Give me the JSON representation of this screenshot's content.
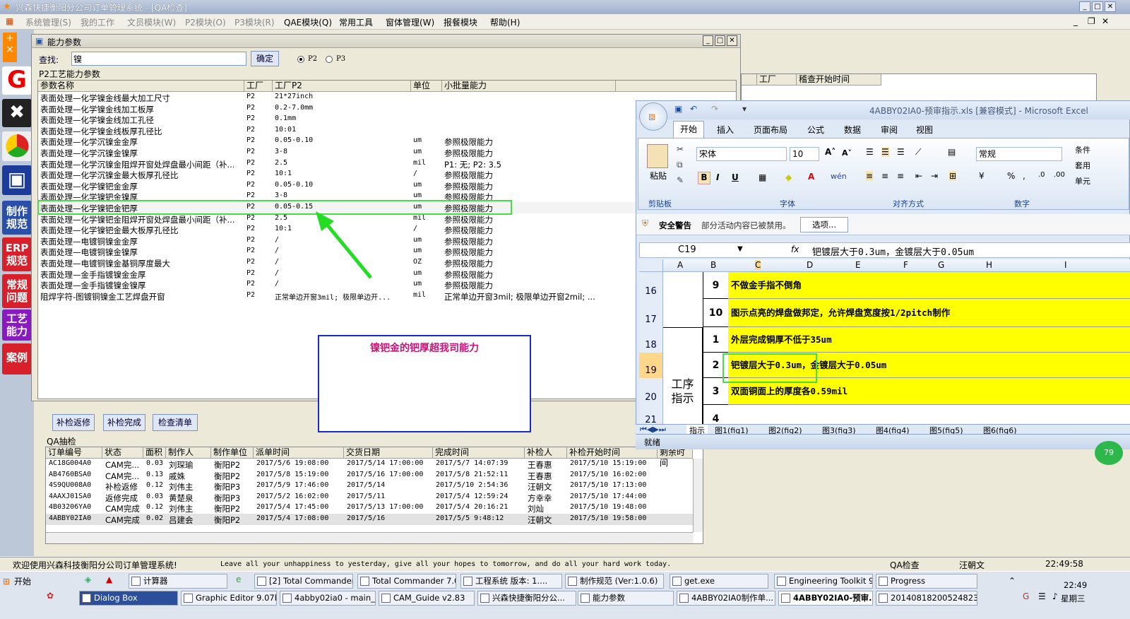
{
  "app": {
    "title": "兴森快捷衡阳分公司订单管理系统 - [QA检查]"
  },
  "menu": [
    "系统管理(S)",
    "我的工作",
    "文员模块(W)",
    "P2模块(O)",
    "P3模块(R)",
    "QAE模块(Q)",
    "常用工具",
    "窗体管理(W)",
    "报餐模块",
    "帮助(H)"
  ],
  "sidebar": {
    "buttons": [
      "制作\n规范",
      "ERP\n规范",
      "常规\n问题",
      "工艺\n能力",
      "案例"
    ]
  },
  "dialog": {
    "title": "能力参数",
    "search_label": "查找:",
    "search_value": "镍",
    "confirm": "确定",
    "radio_p2": "P2",
    "radio_p3": "P3",
    "group": "P2工艺能力参数",
    "columns": [
      "参数名称",
      "工厂",
      "工厂P2",
      "单位",
      "小批量能力"
    ],
    "rows": [
      [
        "表面处理—化学镍金线最大加工尺寸",
        "P2",
        "21*27inch",
        "",
        ""
      ],
      [
        "表面处理—化学镍金线加工板厚",
        "P2",
        "0.2-7.0mm",
        "",
        ""
      ],
      [
        "表面处理—化学镍金线加工孔径",
        "P2",
        "0.1mm",
        "",
        ""
      ],
      [
        "表面处理—化学镍金线板厚孔径比",
        "P2",
        "10:01",
        "",
        ""
      ],
      [
        "表面处理—化学沉镍金金厚",
        "P2",
        "0.05-0.10",
        "um",
        "参照极限能力"
      ],
      [
        "表面处理—化学沉镍金镍厚",
        "P2",
        "3-8",
        "um",
        "参照极限能力"
      ],
      [
        "表面处理—化学沉镍金阻焊开窗处焊盘最小间距（补...",
        "P2",
        "2.5",
        "mil",
        "P1: 无; P2: 3.5"
      ],
      [
        "表面处理—化学沉镍金最大板厚孔径比",
        "P2",
        "10:1",
        "/",
        "参照极限能力"
      ],
      [
        "表面处理—化学镍钯金金厚",
        "P2",
        "0.05-0.10",
        "um",
        "参照极限能力"
      ],
      [
        "表面处理—化学镍钯金镍厚",
        "P2",
        "3-8",
        "um",
        "参照极限能力"
      ],
      [
        "表面处理—化学镍钯金钯厚",
        "P2",
        "0.05-0.15",
        "um",
        "参照极限能力"
      ],
      [
        "表面处理—化学镍钯金阻焊开窗处焊盘最小间距（补...",
        "P2",
        "2.5",
        "mil",
        "参照极限能力"
      ],
      [
        "表面处理—化学镍钯金最大板厚孔径比",
        "P2",
        "10:1",
        "/",
        "参照极限能力"
      ],
      [
        "表面处理—电镀铜镍金金厚",
        "P2",
        "/",
        "um",
        "参照极限能力"
      ],
      [
        "表面处理—电镀铜镍金镍厚",
        "P2",
        "/",
        "um",
        "参照极限能力"
      ],
      [
        "表面处理—电镀铜镍金基铜厚度最大",
        "P2",
        "/",
        "OZ",
        "参照极限能力"
      ],
      [
        "表面处理—金手指镀镍金金厚",
        "P2",
        "/",
        "um",
        "参照极限能力"
      ],
      [
        "表面处理—金手指镀镍金镍厚",
        "P2",
        "/",
        "um",
        "参照极限能力"
      ],
      [
        "阻焊字符-图镀铜镍金工艺焊盘开窗",
        "P2",
        "正常单边开窗3mil; 极限单边开...",
        "mil",
        "正常单边开窗3mil; 极限单边开窗2mil; ..."
      ]
    ],
    "annotation": "镍钯金的钯厚超我司能力"
  },
  "bg_headers": [
    "工厂",
    "稽查开始时间"
  ],
  "buttons": {
    "recheck_return": "补检返修",
    "recheck_done": "补检完成",
    "checklist": "检查清单"
  },
  "qa": {
    "group": "QA抽检",
    "columns": [
      "订单编号",
      "状态",
      "面积",
      "制作人",
      "制作单位",
      "派单时间",
      "交货日期",
      "完成时间",
      "补检人",
      "补检开始时间",
      "剩余时间"
    ],
    "rows": [
      [
        "AC18G004A0",
        "CAM完...",
        "0.03",
        "刘琛瑜",
        "衡阳P2",
        "2017/5/6 19:08:00",
        "2017/5/14 17:00:00",
        "2017/5/7 14:07:39",
        "王春惠",
        "2017/5/10 15:19:00",
        ""
      ],
      [
        "AB4760BSA0",
        "CAM完...",
        "0.13",
        "戚姝",
        "衡阳P2",
        "2017/5/8 15:19:00",
        "2017/5/16 17:00:00",
        "2017/5/8 21:52:11",
        "王春惠",
        "2017/5/10 16:02:00",
        ""
      ],
      [
        "4S9QU008A0",
        "补检返修",
        "0.12",
        "刘伟主",
        "衡阳P3",
        "2017/5/9 17:46:00",
        "2017/5/14",
        "2017/5/10 2:54:36",
        "汪朝文",
        "2017/5/10 17:13:00",
        ""
      ],
      [
        "4AAXJ01SA0",
        "返修完成",
        "0.03",
        "黄楚泉",
        "衡阳P3",
        "2017/5/2 16:02:00",
        "2017/5/11",
        "2017/5/4 12:59:24",
        "方幸幸",
        "2017/5/10 17:44:00",
        ""
      ],
      [
        "4B03206YA0",
        "CAM完成",
        "0.12",
        "刘伟主",
        "衡阳P2",
        "2017/5/4 17:45:00",
        "2017/5/13 17:00:00",
        "2017/5/4 20:16:21",
        "刘灿",
        "2017/5/10 19:48:00",
        ""
      ],
      [
        "4ABBY02IA0",
        "CAM完成",
        "0.02",
        "吕建会",
        "衡阳P2",
        "2017/5/4 17:08:00",
        "2017/5/16",
        "2017/5/5 9:48:12",
        "汪朝文",
        "2017/5/10 19:58:00",
        ""
      ]
    ]
  },
  "excel": {
    "title": "4ABBY02IA0-预审指示.xls [兼容模式] - Microsoft Excel",
    "tabs": [
      "开始",
      "插入",
      "页面布局",
      "公式",
      "数据",
      "审阅",
      "视图"
    ],
    "font_name": "宋体",
    "font_size": "10",
    "number_format": "常规",
    "groups": [
      "剪贴板",
      "字体",
      "对齐方式",
      "数字"
    ],
    "paste": "粘贴",
    "right_items": [
      "条件",
      "套用",
      "单元"
    ],
    "security_label": "安全警告",
    "security_text": "部分活动内容已被禁用。",
    "options": "选项...",
    "cell_ref": "C19",
    "fx": "fx",
    "formula": "钯镀层大于0.3um，金镀层大于0.05um",
    "cols": [
      "A",
      "B",
      "C",
      "D",
      "E",
      "F",
      "G",
      "H",
      "I"
    ],
    "rows": [
      {
        "num": "16",
        "b": "9",
        "c": "不做金手指不倒角"
      },
      {
        "num": "17",
        "b": "10",
        "c": "图示点亮的焊盘做邦定，允许焊盘宽度按1/2pitch制作"
      },
      {
        "num": "18",
        "b": "1",
        "c": "外层完成铜厚不低于35um"
      },
      {
        "num": "19",
        "b": "2",
        "c": "钯镀层大于0.3um，金镀层大于0.05um"
      },
      {
        "num": "20",
        "b": "3",
        "c": "双面铜面上的厚度各0.59mil"
      },
      {
        "num": "21",
        "b": "4",
        "c": ""
      }
    ],
    "merged_label": "工序\n指示",
    "sheets": [
      "指示",
      "图1(fig1)",
      "图2(fig2)",
      "图3(fig3)",
      "图4(fig4)",
      "图5(fig5)",
      "图6(fig6)"
    ],
    "status": "就绪"
  },
  "statusbar": {
    "welcome": "欢迎使用兴森科技衡阳分公司订单管理系统!",
    "motto": "Leave all your unhappiness to yesterday, give all your hopes to tomorrow, and do all your hard work today.",
    "module": "QA检查",
    "user": "汪朝文",
    "time": "22:49:58"
  },
  "taskbar": {
    "start": "开始",
    "row1": [
      "计算器",
      "[2] Total Commander ...",
      "Total Commander 7.0 ...",
      "工程系统 版本: 1....",
      "制作规范 (Ver:1.0.6)",
      "get.exe",
      "Engineering Toolkit 9....",
      "Progress"
    ],
    "row2": [
      "Dialog Box",
      "Graphic Editor 9.07b...",
      "4abby02ia0 - main_qa",
      "CAM_Guide v2.83",
      "兴森快捷衡阳分公...",
      "能力参数",
      "4ABBY02IA0制作单...",
      "4ABBY02IA0-预审...",
      "20140818200524823..."
    ],
    "clock": "22:49",
    "day": "星期三"
  }
}
